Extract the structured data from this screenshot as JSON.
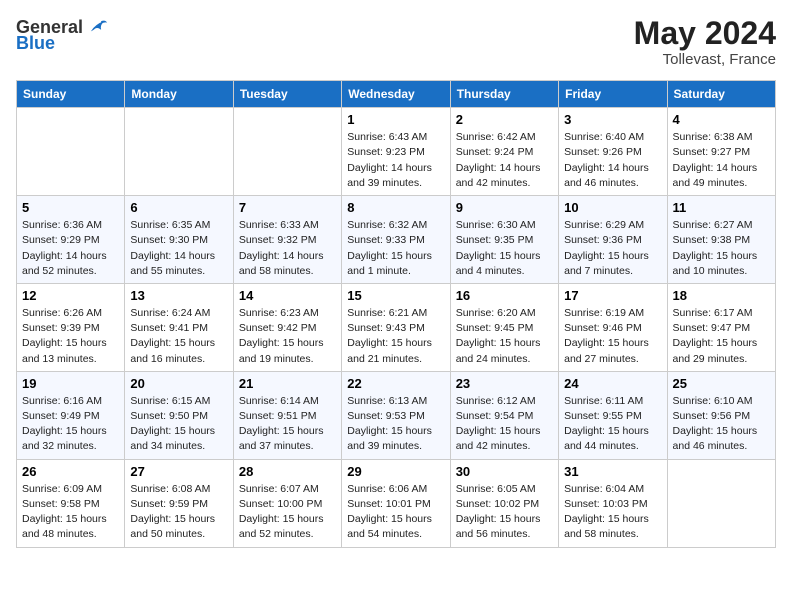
{
  "header": {
    "logo_general": "General",
    "logo_blue": "Blue",
    "title": "May 2024",
    "location": "Tollevast, France"
  },
  "weekdays": [
    "Sunday",
    "Monday",
    "Tuesday",
    "Wednesday",
    "Thursday",
    "Friday",
    "Saturday"
  ],
  "weeks": [
    [
      {
        "day": "",
        "info": ""
      },
      {
        "day": "",
        "info": ""
      },
      {
        "day": "",
        "info": ""
      },
      {
        "day": "1",
        "info": "Sunrise: 6:43 AM\nSunset: 9:23 PM\nDaylight: 14 hours and 39 minutes."
      },
      {
        "day": "2",
        "info": "Sunrise: 6:42 AM\nSunset: 9:24 PM\nDaylight: 14 hours and 42 minutes."
      },
      {
        "day": "3",
        "info": "Sunrise: 6:40 AM\nSunset: 9:26 PM\nDaylight: 14 hours and 46 minutes."
      },
      {
        "day": "4",
        "info": "Sunrise: 6:38 AM\nSunset: 9:27 PM\nDaylight: 14 hours and 49 minutes."
      }
    ],
    [
      {
        "day": "5",
        "info": "Sunrise: 6:36 AM\nSunset: 9:29 PM\nDaylight: 14 hours and 52 minutes."
      },
      {
        "day": "6",
        "info": "Sunrise: 6:35 AM\nSunset: 9:30 PM\nDaylight: 14 hours and 55 minutes."
      },
      {
        "day": "7",
        "info": "Sunrise: 6:33 AM\nSunset: 9:32 PM\nDaylight: 14 hours and 58 minutes."
      },
      {
        "day": "8",
        "info": "Sunrise: 6:32 AM\nSunset: 9:33 PM\nDaylight: 15 hours and 1 minute."
      },
      {
        "day": "9",
        "info": "Sunrise: 6:30 AM\nSunset: 9:35 PM\nDaylight: 15 hours and 4 minutes."
      },
      {
        "day": "10",
        "info": "Sunrise: 6:29 AM\nSunset: 9:36 PM\nDaylight: 15 hours and 7 minutes."
      },
      {
        "day": "11",
        "info": "Sunrise: 6:27 AM\nSunset: 9:38 PM\nDaylight: 15 hours and 10 minutes."
      }
    ],
    [
      {
        "day": "12",
        "info": "Sunrise: 6:26 AM\nSunset: 9:39 PM\nDaylight: 15 hours and 13 minutes."
      },
      {
        "day": "13",
        "info": "Sunrise: 6:24 AM\nSunset: 9:41 PM\nDaylight: 15 hours and 16 minutes."
      },
      {
        "day": "14",
        "info": "Sunrise: 6:23 AM\nSunset: 9:42 PM\nDaylight: 15 hours and 19 minutes."
      },
      {
        "day": "15",
        "info": "Sunrise: 6:21 AM\nSunset: 9:43 PM\nDaylight: 15 hours and 21 minutes."
      },
      {
        "day": "16",
        "info": "Sunrise: 6:20 AM\nSunset: 9:45 PM\nDaylight: 15 hours and 24 minutes."
      },
      {
        "day": "17",
        "info": "Sunrise: 6:19 AM\nSunset: 9:46 PM\nDaylight: 15 hours and 27 minutes."
      },
      {
        "day": "18",
        "info": "Sunrise: 6:17 AM\nSunset: 9:47 PM\nDaylight: 15 hours and 29 minutes."
      }
    ],
    [
      {
        "day": "19",
        "info": "Sunrise: 6:16 AM\nSunset: 9:49 PM\nDaylight: 15 hours and 32 minutes."
      },
      {
        "day": "20",
        "info": "Sunrise: 6:15 AM\nSunset: 9:50 PM\nDaylight: 15 hours and 34 minutes."
      },
      {
        "day": "21",
        "info": "Sunrise: 6:14 AM\nSunset: 9:51 PM\nDaylight: 15 hours and 37 minutes."
      },
      {
        "day": "22",
        "info": "Sunrise: 6:13 AM\nSunset: 9:53 PM\nDaylight: 15 hours and 39 minutes."
      },
      {
        "day": "23",
        "info": "Sunrise: 6:12 AM\nSunset: 9:54 PM\nDaylight: 15 hours and 42 minutes."
      },
      {
        "day": "24",
        "info": "Sunrise: 6:11 AM\nSunset: 9:55 PM\nDaylight: 15 hours and 44 minutes."
      },
      {
        "day": "25",
        "info": "Sunrise: 6:10 AM\nSunset: 9:56 PM\nDaylight: 15 hours and 46 minutes."
      }
    ],
    [
      {
        "day": "26",
        "info": "Sunrise: 6:09 AM\nSunset: 9:58 PM\nDaylight: 15 hours and 48 minutes."
      },
      {
        "day": "27",
        "info": "Sunrise: 6:08 AM\nSunset: 9:59 PM\nDaylight: 15 hours and 50 minutes."
      },
      {
        "day": "28",
        "info": "Sunrise: 6:07 AM\nSunset: 10:00 PM\nDaylight: 15 hours and 52 minutes."
      },
      {
        "day": "29",
        "info": "Sunrise: 6:06 AM\nSunset: 10:01 PM\nDaylight: 15 hours and 54 minutes."
      },
      {
        "day": "30",
        "info": "Sunrise: 6:05 AM\nSunset: 10:02 PM\nDaylight: 15 hours and 56 minutes."
      },
      {
        "day": "31",
        "info": "Sunrise: 6:04 AM\nSunset: 10:03 PM\nDaylight: 15 hours and 58 minutes."
      },
      {
        "day": "",
        "info": ""
      }
    ]
  ]
}
